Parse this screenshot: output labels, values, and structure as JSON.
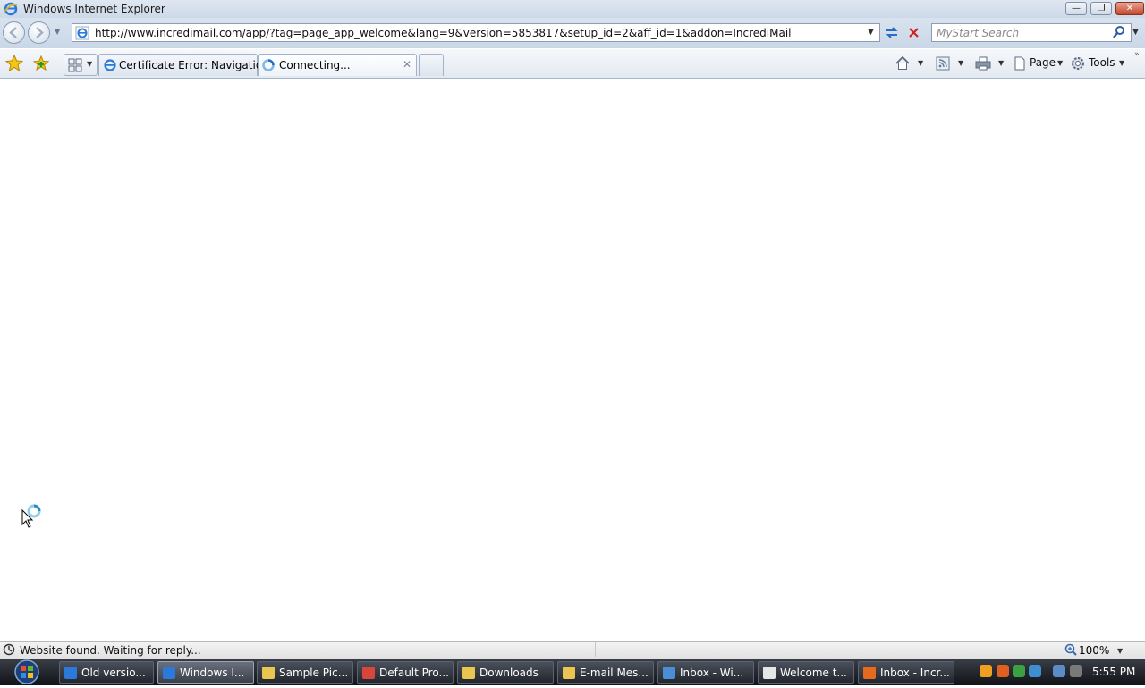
{
  "window": {
    "title": "Windows Internet Explorer",
    "controls": {
      "minimize": "—",
      "maximize": "❐",
      "close": "✕"
    }
  },
  "navbar": {
    "address": "http://www.incredimail.com/app/?tag=page_app_welcome&lang=9&version=5853817&setup_id=2&aff_id=1&addon=IncrediMail",
    "search_placeholder": "MyStart Search"
  },
  "tabs": [
    {
      "label": "Certificate Error: Navigatio..."
    },
    {
      "label": "Connecting..."
    }
  ],
  "toolbar": {
    "page_label": "Page",
    "tools_label": "Tools"
  },
  "status": {
    "text": "Website found. Waiting for reply...",
    "zoom": "100%"
  },
  "taskbar": {
    "items": [
      {
        "label": "Old versio...",
        "icon": "ie-icon"
      },
      {
        "label": "Windows I...",
        "icon": "ie-icon",
        "active": true
      },
      {
        "label": "Sample Pic...",
        "icon": "folder-icon"
      },
      {
        "label": "Default Pro...",
        "icon": "chrome-icon"
      },
      {
        "label": "Downloads",
        "icon": "folder-icon"
      },
      {
        "label": "E-mail Mes...",
        "icon": "folder-icon"
      },
      {
        "label": "Inbox - Wi...",
        "icon": "mail-icon"
      },
      {
        "label": "Welcome t...",
        "icon": "envelope-icon"
      },
      {
        "label": "Inbox - Incr...",
        "icon": "incredimail-icon"
      }
    ],
    "clock": "5:55 PM"
  },
  "colors": {
    "accent": "#1f5fb4",
    "taskbar": "#1a1d22",
    "ie_blue": "#2b7ad9"
  }
}
